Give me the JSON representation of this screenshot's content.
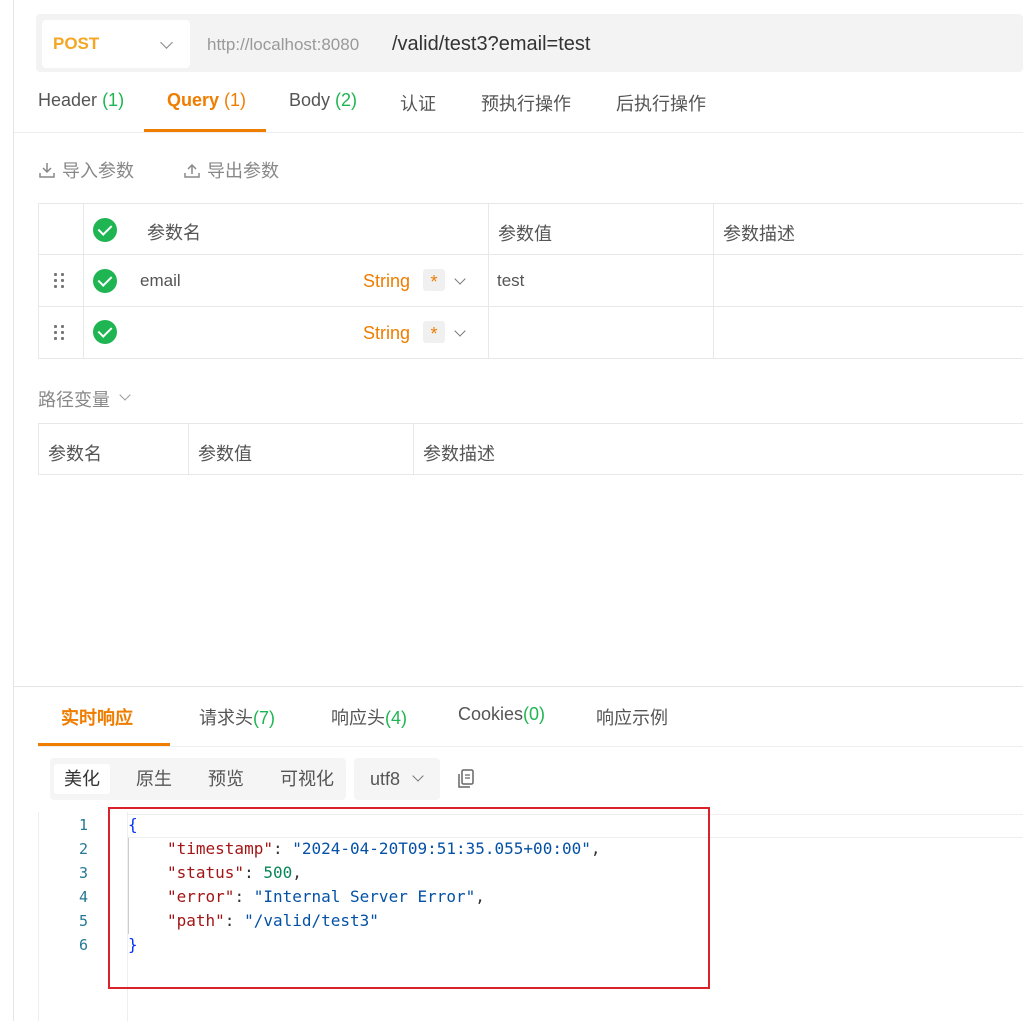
{
  "request": {
    "method": "POST",
    "host": "http://localhost:8080",
    "path": "/valid/test3?email=test"
  },
  "tabs": [
    {
      "label": "Header",
      "count": "(1)"
    },
    {
      "label": "Query",
      "count": "(1)"
    },
    {
      "label": "Body",
      "count": "(2)"
    },
    {
      "label": "认证",
      "count": ""
    },
    {
      "label": "预执行操作",
      "count": ""
    },
    {
      "label": "后执行操作",
      "count": ""
    }
  ],
  "tools": {
    "import": "导入参数",
    "export": "导出参数"
  },
  "query_table": {
    "headers": [
      "参数名",
      "参数值",
      "参数描述"
    ],
    "rows": [
      {
        "name": "email",
        "type": "String",
        "required": "*",
        "value": "test",
        "desc": ""
      },
      {
        "name": "",
        "type": "String",
        "required": "*",
        "value": "",
        "desc": ""
      }
    ]
  },
  "path_vars": {
    "title": "路径变量",
    "headers": [
      "参数名",
      "参数值",
      "参数描述"
    ]
  },
  "response": {
    "tabs": [
      {
        "label": "实时响应",
        "count": ""
      },
      {
        "label": "请求头",
        "count": "(7)"
      },
      {
        "label": "响应头",
        "count": "(4)"
      },
      {
        "label": "Cookies",
        "count": "(0)"
      },
      {
        "label": "响应示例",
        "count": ""
      }
    ],
    "view_modes": [
      "美化",
      "原生",
      "预览",
      "可视化"
    ],
    "encoding": "utf8",
    "line_numbers": [
      "1",
      "2",
      "3",
      "4",
      "5",
      "6"
    ],
    "body": {
      "open": "{",
      "timestamp_key": "\"timestamp\"",
      "timestamp_val": "\"2024-04-20T09:51:35.055+00:00\"",
      "status_key": "\"status\"",
      "status_val": "500",
      "error_key": "\"error\"",
      "error_val": "\"Internal Server Error\"",
      "path_key": "\"path\"",
      "path_val": "\"/valid/test3\"",
      "close": "}"
    }
  }
}
